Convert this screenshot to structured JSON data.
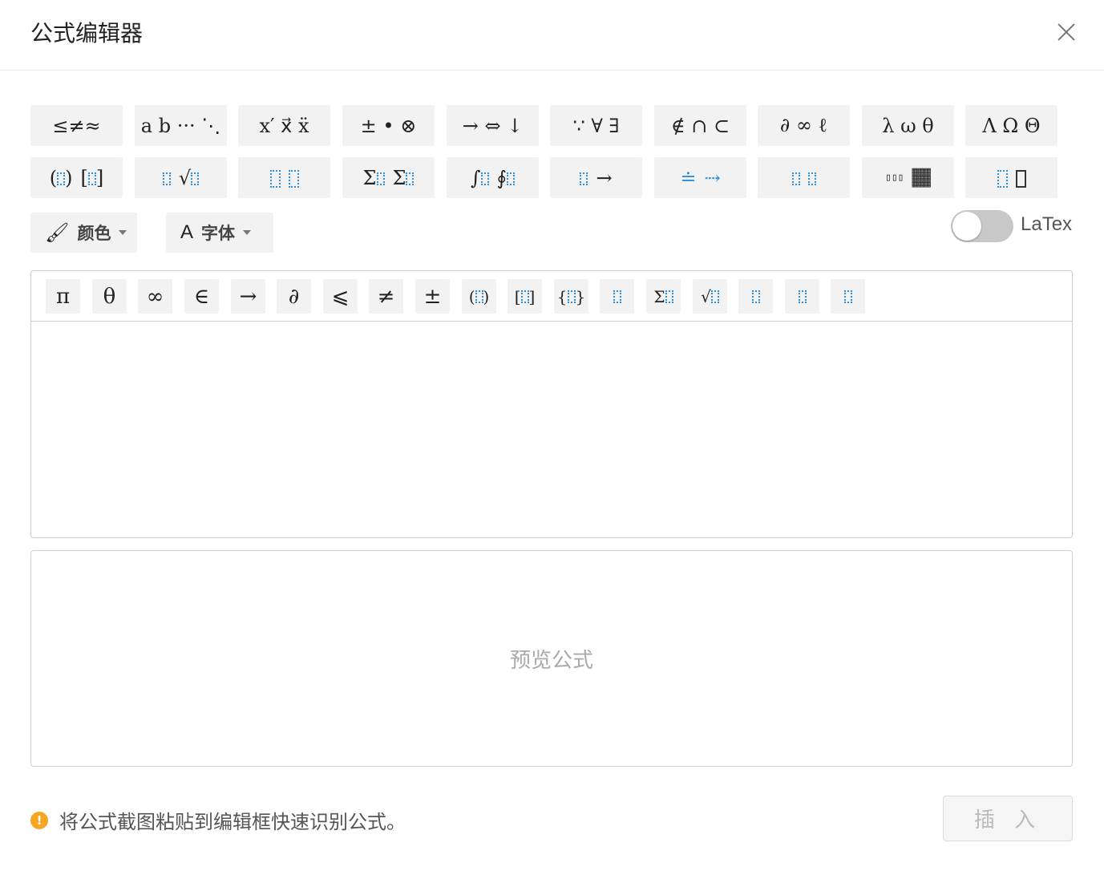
{
  "dialog": {
    "title": "公式编辑器"
  },
  "symbol_groups_row1": [
    "≤≠≈",
    "a b ··· ⋱",
    "x′ x⃗ ẍ",
    "± • ⊗",
    "→ ⇔ ↓",
    "∵ ∀ ∃",
    "∉ ∩ ⊂",
    "∂ ∞ ℓ",
    "λ ω θ",
    "Λ Ω Θ"
  ],
  "template_groups_row2": [
    "brackets",
    "fraction-root",
    "scripts",
    "sum",
    "integral",
    "over-arrow",
    "equals-arrow",
    "under-over",
    "matrix",
    "box"
  ],
  "dropdowns": {
    "color_label": "颜色",
    "font_label": "字体"
  },
  "latex_toggle": {
    "label": "LaTex",
    "enabled": false
  },
  "editor_toolbar": [
    "π",
    "θ",
    "∞",
    "∈",
    "→",
    "∂",
    "⩽",
    "≠",
    "±",
    "(⁞)",
    "[⁞]",
    "{⁞}",
    "frac",
    "sum",
    "sqrt",
    "sup",
    "sub",
    "subsup"
  ],
  "preview": {
    "placeholder": "预览公式"
  },
  "footer": {
    "hint": "将公式截图粘贴到编辑框快速识别公式。",
    "insert_label": "插 入"
  },
  "colors": {
    "slot_blue": "#2b8fdd",
    "warn_orange": "#f5a623",
    "button_bg": "#f2f2f2"
  }
}
